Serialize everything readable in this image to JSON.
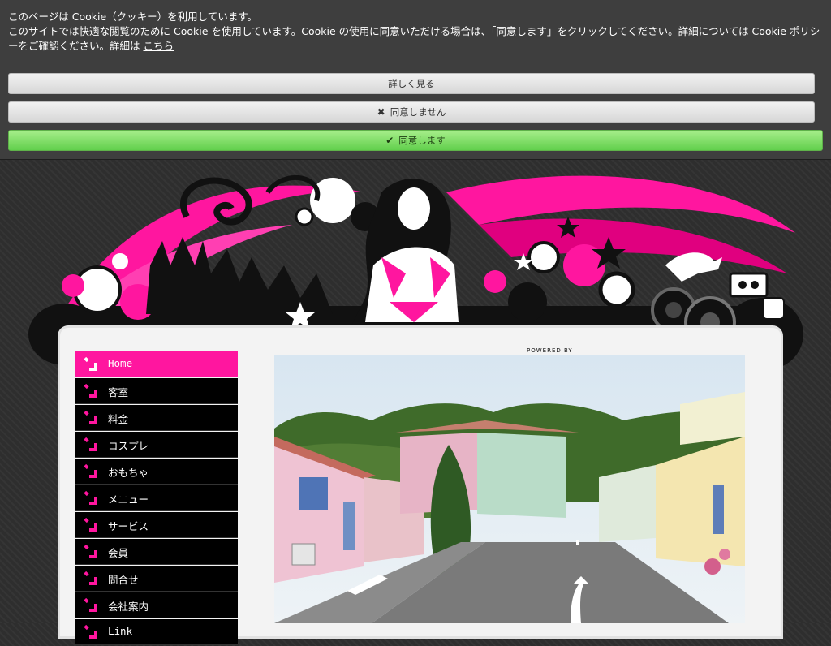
{
  "cookie_banner": {
    "line1": "このページは Cookie（クッキー）を利用しています。",
    "line2": "このサイトでは快適な閲覧のために Cookie を使用しています。Cookie の使用に同意いただける場合は、「同意します」をクリックしてください。詳細については Cookie ポリシーをご確認ください。詳細は ",
    "link": "こちら",
    "details_button": "詳しく見る",
    "decline_button": "同意しません",
    "accept_button": "同意します",
    "decline_icon": "✖",
    "accept_icon": "✔"
  },
  "powered_by": "POWERED BY",
  "nav": {
    "items": [
      {
        "label": "Home",
        "active": true
      },
      {
        "label": "客室"
      },
      {
        "label": "料金"
      },
      {
        "label": "コスプレ"
      },
      {
        "label": "おもちゃ"
      },
      {
        "label": "メニュー"
      },
      {
        "label": "サービス"
      },
      {
        "label": "会員"
      },
      {
        "label": "問合せ"
      },
      {
        "label": "会社案内"
      },
      {
        "label": "Link"
      }
    ]
  },
  "colors": {
    "accent_pink": "#ff169f",
    "accept_green": "#61cf4c",
    "nav_black": "#000000"
  },
  "icons": {
    "nav_arrow": "arrow-down-right-icon"
  }
}
